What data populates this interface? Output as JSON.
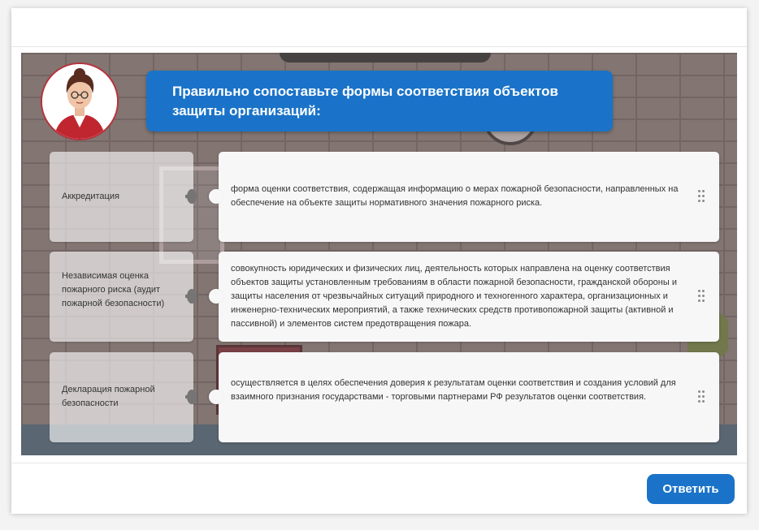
{
  "question": {
    "title": "Правильно сопоставьте формы соответствия объектов защиты организаций:"
  },
  "terms": [
    {
      "label": "Аккредитация"
    },
    {
      "label": "Независимая оценка пожарного риска (аудит пожарной безопасности)"
    },
    {
      "label": "Декларация пожарной безопасности"
    }
  ],
  "definitions": [
    {
      "text": "форма оценки соответствия, содержащая информацию о мерах пожарной безопасности, направленных на обеспечение на объекте защиты нормативного значения пожарного риска."
    },
    {
      "text": "совокупность юридических и физических лиц, деятельность которых направлена на оценку соответствия объектов защиты установленным требованиям в области пожарной безопасности, гражданской обороны и защиты населения от чрезвычайных ситуаций природного и техногенного характера, организационных и инженерно-технических мероприятий, а также технических средств противопожарной защиты (активной и пассивной) и элементов систем предотвращения пожара."
    },
    {
      "text": "осуществляется в целях обеспечения доверия к результатам оценки соответствия и создания условий для взаимного признания государствами - торговыми партнерами РФ результатов оценки соответствия."
    }
  ],
  "footer": {
    "answer_label": "Ответить"
  },
  "colors": {
    "accent": "#1a73c8",
    "avatar_border": "#b6323b",
    "knob": "#757575"
  },
  "icons": {
    "drag": "drag-handle-icon",
    "avatar": "presenter-avatar"
  }
}
